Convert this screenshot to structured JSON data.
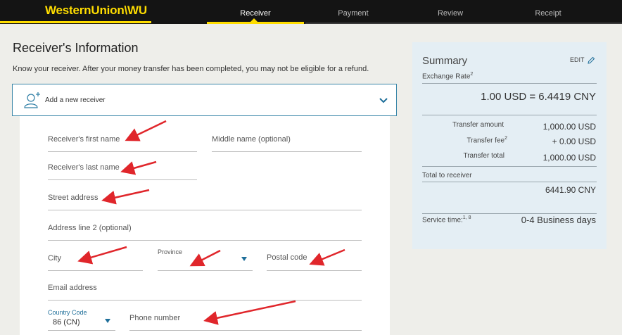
{
  "nav": {
    "logo_text": "WesternUnion\\WU",
    "steps": [
      {
        "label": "Receiver",
        "active": true
      },
      {
        "label": "Payment",
        "active": false
      },
      {
        "label": "Review",
        "active": false
      },
      {
        "label": "Receipt",
        "active": false
      }
    ]
  },
  "colors": {
    "accent_yellow": "#ffdd00",
    "nav_bg": "#141414",
    "link_blue": "#1f6f9a",
    "annotation_red": "#e0262b",
    "summary_bg": "#e4eef4"
  },
  "main": {
    "title": "Receiver's Information",
    "subtitle": "Know your receiver. After your money transfer has been completed, you may not be eligible for a refund.",
    "receiver_select": {
      "label": "Add a new receiver",
      "icon": "add-person-icon",
      "chevron_icon": "chevron-down-icon"
    },
    "form": {
      "first_name_placeholder": "Receiver's first name",
      "middle_name_placeholder": "Middle name (optional)",
      "last_name_placeholder": "Receiver's last name",
      "street_placeholder": "Street address",
      "address2_placeholder": "Address line 2 (optional)",
      "city_placeholder": "City",
      "province_label": "Province",
      "postal_placeholder": "Postal code",
      "email_placeholder": "Email address",
      "country_code_label": "Country Code",
      "country_code_value": "86 (CN)",
      "phone_placeholder": "Phone number"
    }
  },
  "summary": {
    "title": "Summary",
    "edit_label": "EDIT",
    "edit_icon": "pencil-icon",
    "exchange_rate_label": "Exchange Rate",
    "exchange_rate_sup": "2",
    "rate_value": "1.00 USD = 6.4419 CNY",
    "transfer_amount_label": "Transfer amount",
    "transfer_amount_value": "1,000.00 USD",
    "transfer_fee_label": "Transfer fee",
    "transfer_fee_sup": "2",
    "transfer_fee_value": "+ 0.00 USD",
    "transfer_total_label": "Transfer total",
    "transfer_total_value": "1,000.00 USD",
    "total_to_receiver_label": "Total  to receiver",
    "total_to_receiver_value": "6441.90 CNY",
    "service_time_label": "Service time:",
    "service_time_sup": "1, 8",
    "service_time_value": "0-4 Business days"
  }
}
